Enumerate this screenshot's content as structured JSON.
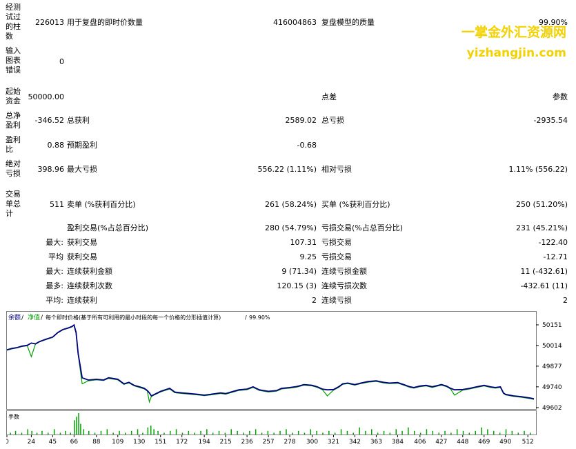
{
  "report": {
    "bars_label": "经测试过的柱数",
    "bars_value": "226013",
    "ticks_label": "用于复盘的即时价数量",
    "ticks_value": "416004863",
    "quality_label": "复盘模型的质量",
    "quality_value": "99.90%",
    "errors_label": "输入图表错误",
    "errors_value": "0",
    "deposit_label": "起始资金",
    "deposit_value": "50000.00",
    "spread_label": "点差",
    "spread_value": "参数",
    "net_label": "总净盈利",
    "net_value": "-346.52",
    "gross_profit_label": "总获利",
    "gross_profit_value": "2589.02",
    "gross_loss_label": "总亏损",
    "gross_loss_value": "-2935.54",
    "pf_label": "盈利比",
    "pf_value": "0.88",
    "expected_label": "预期盈利",
    "expected_value": "-0.68",
    "abs_dd_label": "绝对亏损",
    "abs_dd_value": "398.96",
    "max_dd_label": "最大亏损",
    "max_dd_value": "556.22 (1.11%)",
    "rel_dd_label": "相对亏损",
    "rel_dd_value": "1.11% (556.22)",
    "trades_label": "交易单总计",
    "trades_value": "511",
    "short_label": "卖单 (%获利百分比)",
    "short_value": "261 (58.24%)",
    "long_label": "买单 (%获利百分比)",
    "long_value": "250 (51.20%)",
    "win_label": "盈利交易(%占总百分比)",
    "win_value": "280 (54.79%)",
    "loss_label": "亏损交易(%占总百分比)",
    "loss_value": "231 (45.21%)",
    "largest_prefix": "最大:",
    "largest_win_label": "获利交易",
    "largest_win_value": "107.31",
    "largest_loss_label": "亏损交易",
    "largest_loss_value": "-122.40",
    "avg_prefix": "平均",
    "avg_win_label": "获利交易",
    "avg_win_value": "9.25",
    "avg_loss_label": "亏损交易",
    "avg_loss_value": "-12.71",
    "maxcons_prefix": "最大:",
    "maxcons_win_label": "连续获利金额",
    "maxcons_win_value": "9 (71.34)",
    "maxcons_loss_label": "连续亏损金额",
    "maxcons_loss_value": "11 (-432.61)",
    "maxprofit_prefix": "最多:",
    "maxprofit_win_label": "连续获利次数",
    "maxprofit_win_value": "120.15 (3)",
    "maxprofit_loss_label": "连续亏损次数",
    "maxprofit_loss_value": "-432.61 (11)",
    "avgcons_prefix": "平均:",
    "avgcons_win_label": "连续获利",
    "avgcons_win_value": "2",
    "avgcons_loss_label": "连续亏损",
    "avgcons_loss_value": "2"
  },
  "watermark": {
    "cn": "一掌金外汇资源网",
    "url": "yizhangjin.com",
    "color": "#f4d100"
  },
  "chart_data": {
    "type": "line",
    "legend": {
      "balance": "余额",
      "equity": "净值",
      "model": "每个即时价格(基于所有可利用的最小时段的每一个价格的分形插值计算)",
      "quality": "99.90%"
    },
    "volume_label": "手数",
    "yticks": [
      "50151",
      "50014",
      "49877",
      "49740",
      "49602"
    ],
    "ylim": [
      49602,
      50151
    ],
    "xticks": [
      "0",
      "24",
      "45",
      "66",
      "88",
      "109",
      "130",
      "151",
      "172",
      "194",
      "215",
      "236",
      "257",
      "278",
      "300",
      "321",
      "342",
      "363",
      "384",
      "406",
      "427",
      "448",
      "469",
      "490",
      "512"
    ],
    "xlim": [
      0,
      520
    ],
    "series": [
      {
        "name": "余额",
        "color": "#000080",
        "x": [
          0,
          5,
          10,
          15,
          20,
          24,
          28,
          32,
          38,
          45,
          50,
          55,
          60,
          64,
          66,
          68,
          70,
          74,
          80,
          88,
          95,
          100,
          109,
          115,
          120,
          125,
          130,
          135,
          138,
          140,
          142,
          145,
          151,
          160,
          165,
          172,
          180,
          188,
          194,
          200,
          210,
          215,
          220,
          228,
          236,
          242,
          248,
          257,
          265,
          270,
          278,
          285,
          292,
          300,
          305,
          310,
          315,
          321,
          326,
          330,
          335,
          342,
          348,
          355,
          363,
          370,
          376,
          384,
          390,
          396,
          400,
          406,
          412,
          418,
          427,
          432,
          436,
          440,
          448,
          455,
          462,
          469,
          475,
          480,
          485,
          488,
          490,
          494,
          498,
          505,
          510,
          515,
          518
        ],
        "y": [
          49985,
          49995,
          50000,
          50010,
          50015,
          50030,
          50025,
          50040,
          50055,
          50070,
          50100,
          50120,
          50130,
          50140,
          50150,
          50100,
          49960,
          49800,
          49785,
          49790,
          49785,
          49800,
          49790,
          49760,
          49770,
          49750,
          49740,
          49730,
          49715,
          49700,
          49680,
          49690,
          49710,
          49730,
          49705,
          49700,
          49695,
          49690,
          49685,
          49690,
          49700,
          49695,
          49705,
          49720,
          49725,
          49740,
          49720,
          49710,
          49715,
          49730,
          49735,
          49742,
          49755,
          49750,
          49740,
          49725,
          49720,
          49722,
          49740,
          49760,
          49765,
          49755,
          49765,
          49775,
          49780,
          49770,
          49765,
          49768,
          49755,
          49740,
          49735,
          49745,
          49750,
          49740,
          49755,
          49745,
          49730,
          49720,
          49722,
          49730,
          49740,
          49750,
          49740,
          49735,
          49740,
          49700,
          49690,
          49685,
          49680,
          49675,
          49670,
          49665,
          49660
        ]
      },
      {
        "name": "净值",
        "color": "#00a000",
        "x": [
          0,
          5,
          10,
          15,
          20,
          24,
          28,
          32,
          38,
          45,
          50,
          55,
          60,
          64,
          66,
          68,
          70,
          74,
          80,
          88,
          95,
          100,
          109,
          115,
          120,
          125,
          130,
          135,
          138,
          140,
          142,
          145,
          151,
          160,
          165,
          172,
          180,
          188,
          194,
          200,
          210,
          215,
          220,
          228,
          236,
          242,
          248,
          257,
          265,
          270,
          278,
          285,
          292,
          300,
          305,
          310,
          315,
          321,
          326,
          330,
          335,
          342,
          348,
          355,
          363,
          370,
          376,
          384,
          390,
          396,
          400,
          406,
          412,
          418,
          427,
          432,
          436,
          440,
          448,
          455,
          462,
          469,
          475,
          480,
          485,
          488,
          490,
          494,
          498,
          505,
          510,
          515,
          518
        ],
        "y": [
          49982,
          49992,
          49998,
          50008,
          50012,
          49940,
          50022,
          50038,
          50052,
          50068,
          50098,
          50118,
          50128,
          50138,
          50148,
          50095,
          49955,
          49760,
          49780,
          49786,
          49782,
          49796,
          49786,
          49756,
          49766,
          49746,
          49736,
          49726,
          49712,
          49640,
          49676,
          49686,
          49706,
          49726,
          49701,
          49696,
          49691,
          49686,
          49681,
          49686,
          49696,
          49691,
          49701,
          49716,
          49721,
          49736,
          49716,
          49706,
          49711,
          49726,
          49731,
          49738,
          49751,
          49746,
          49736,
          49721,
          49680,
          49718,
          49736,
          49756,
          49761,
          49751,
          49761,
          49771,
          49776,
          49766,
          49761,
          49764,
          49751,
          49736,
          49731,
          49741,
          49746,
          49736,
          49751,
          49741,
          49726,
          49685,
          49718,
          49726,
          49736,
          49746,
          49736,
          49731,
          49736,
          49696,
          49686,
          49681,
          49676,
          49671,
          49666,
          49661,
          49656
        ]
      }
    ],
    "volume": {
      "x": [
        3,
        8,
        14,
        20,
        24,
        29,
        34,
        40,
        46,
        52,
        57,
        62,
        66,
        68,
        70,
        72,
        75,
        80,
        86,
        92,
        98,
        104,
        110,
        116,
        122,
        128,
        133,
        138,
        141,
        144,
        148,
        154,
        160,
        166,
        172,
        178,
        184,
        190,
        196,
        202,
        208,
        214,
        220,
        226,
        232,
        238,
        244,
        250,
        256,
        262,
        268,
        274,
        280,
        286,
        292,
        298,
        304,
        310,
        316,
        322,
        328,
        334,
        340,
        346,
        352,
        358,
        364,
        370,
        376,
        382,
        388,
        394,
        400,
        406,
        412,
        418,
        424,
        430,
        436,
        442,
        448,
        454,
        460,
        466,
        472,
        478,
        484,
        490,
        496,
        502,
        508,
        514
      ],
      "values": [
        1,
        2,
        1,
        3,
        2,
        1,
        2,
        1,
        3,
        1,
        2,
        1,
        8,
        10,
        12,
        6,
        3,
        2,
        1,
        2,
        3,
        1,
        2,
        1,
        2,
        3,
        1,
        4,
        5,
        3,
        2,
        1,
        2,
        3,
        1,
        2,
        1,
        2,
        3,
        1,
        2,
        1,
        3,
        2,
        1,
        2,
        3,
        1,
        2,
        1,
        2,
        3,
        1,
        2,
        1,
        3,
        2,
        1,
        2,
        1,
        3,
        2,
        1,
        4,
        2,
        3,
        1,
        2,
        1,
        3,
        2,
        4,
        2,
        1,
        3,
        2,
        1,
        2,
        1,
        3,
        2,
        1,
        2,
        4,
        3,
        2,
        1,
        3,
        2,
        1,
        2,
        1
      ]
    }
  }
}
